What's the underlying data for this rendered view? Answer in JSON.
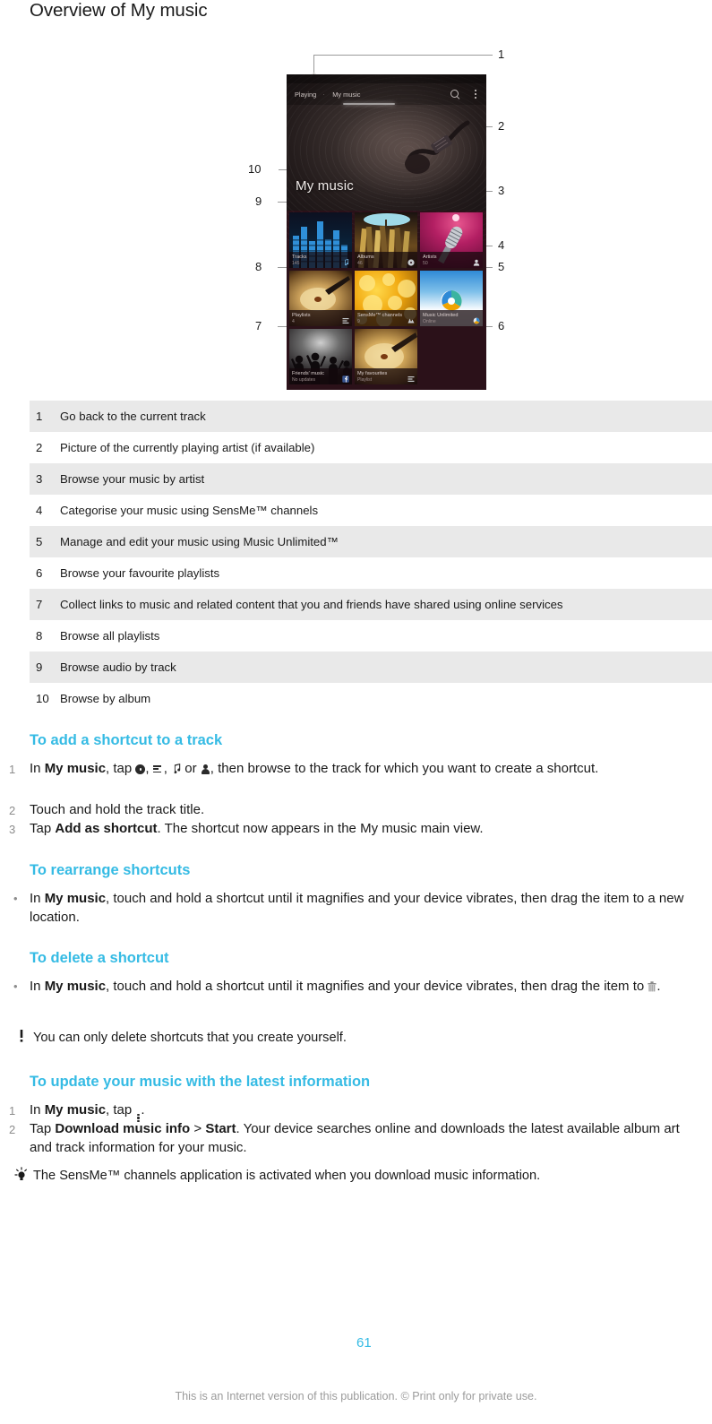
{
  "page_title": "Overview of My music",
  "colors": {
    "accent": "#35bbe4",
    "zebra_row": "#e9e9e9",
    "footer_text": "#9b9b9b",
    "callout_line": "#9a9a9a"
  },
  "figure": {
    "phone": {
      "tabs": [
        {
          "label": "Playing",
          "active": false
        },
        {
          "label": "My music",
          "active": true
        }
      ],
      "actions": [
        {
          "name": "search-icon",
          "label": "Search"
        },
        {
          "name": "overflow-menu-icon",
          "label": "More options"
        }
      ],
      "hero_title": "My music",
      "tiles": [
        {
          "title": "Tracks",
          "subtitle": "145",
          "badge": "music-note-icon"
        },
        {
          "title": "Albums",
          "subtitle": "46",
          "badge": "album-icon"
        },
        {
          "title": "Artists",
          "subtitle": "50",
          "badge": "person-icon"
        },
        {
          "title": "Playlists",
          "subtitle": "4",
          "badge": "playlist-icon"
        },
        {
          "title": "SensMe™ channels",
          "subtitle": "9",
          "badge": "sensme-icon"
        },
        {
          "title": "Music Unlimited",
          "subtitle": "Online",
          "badge": "music-unlimited-icon"
        },
        {
          "title": "Friends' music",
          "subtitle": "No updates",
          "badge": "facebook-icon"
        },
        {
          "title": "My favourites",
          "subtitle": "Playlist",
          "badge": "playlist-icon"
        }
      ]
    },
    "callouts": [
      "1",
      "2",
      "3",
      "4",
      "5",
      "6",
      "7",
      "8",
      "9",
      "10"
    ]
  },
  "legend": {
    "rows": [
      {
        "n": "1",
        "desc": "Go back to the current track"
      },
      {
        "n": "2",
        "desc": "Picture of the currently playing artist (if available)"
      },
      {
        "n": "3",
        "desc": "Browse your music by artist"
      },
      {
        "n": "4",
        "desc": "Categorise your music using SensMe™ channels"
      },
      {
        "n": "5",
        "desc": "Manage and edit your music using Music Unlimited™"
      },
      {
        "n": "6",
        "desc": "Browse your favourite playlists"
      },
      {
        "n": "7",
        "desc": "Collect links to music and related content that you and friends have shared using online services"
      },
      {
        "n": "8",
        "desc": "Browse all playlists"
      },
      {
        "n": "9",
        "desc": "Browse audio by track"
      },
      {
        "n": "10",
        "desc": "Browse by album"
      }
    ]
  },
  "sections": {
    "add_shortcut": {
      "heading": "To add a shortcut to a track",
      "steps": [
        {
          "idx": "1",
          "pre": "In ",
          "bold": "My music",
          "mid": ", tap ",
          "icons": [
            "album-icon",
            "playlist-icon",
            "music-note-icon",
            "person-icon"
          ],
          "sep1": ", ",
          "sep2": ", ",
          "sep3": " or ",
          "post": ", then browse to the track for which you want to create a shortcut."
        },
        {
          "idx": "2",
          "text": "Touch and hold the track title."
        },
        {
          "idx": "3",
          "pre": "Tap ",
          "bold": "Add as shortcut",
          "post": ". The shortcut now appears in the My music main view."
        }
      ]
    },
    "rearrange": {
      "heading": "To rearrange shortcuts",
      "bullet": "•",
      "pre": "In ",
      "bold": "My music",
      "post": ", touch and hold a shortcut until it magnifies and your device vibrates, then drag the item to a new location."
    },
    "delete": {
      "heading": "To delete a shortcut",
      "bullet": "•",
      "pre": "In ",
      "bold": "My music",
      "mid": ", touch and hold a shortcut until it magnifies and your device vibrates, then drag the item to ",
      "trash_icon": "trash-icon",
      "post": ".",
      "note_icon": "exclamation-icon",
      "note": "You can only delete shortcuts that you create yourself."
    },
    "update": {
      "heading": "To update your music with the latest information",
      "steps": [
        {
          "idx": "1",
          "pre": "In ",
          "bold": "My music",
          "mid": ", tap ",
          "icon": "overflow-menu-icon",
          "post": "."
        },
        {
          "idx": "2",
          "pre": "Tap ",
          "bold": "Download music info",
          "mid": " > ",
          "bold2": "Start",
          "post": ". Your device searches online and downloads the latest available album art and track information for your music."
        }
      ],
      "tip_icon": "lightbulb-icon",
      "tip": "The SensMe™ channels application is activated when you download music information."
    }
  },
  "footer": {
    "page_number": "61",
    "text": "This is an Internet version of this publication. © Print only for private use."
  }
}
